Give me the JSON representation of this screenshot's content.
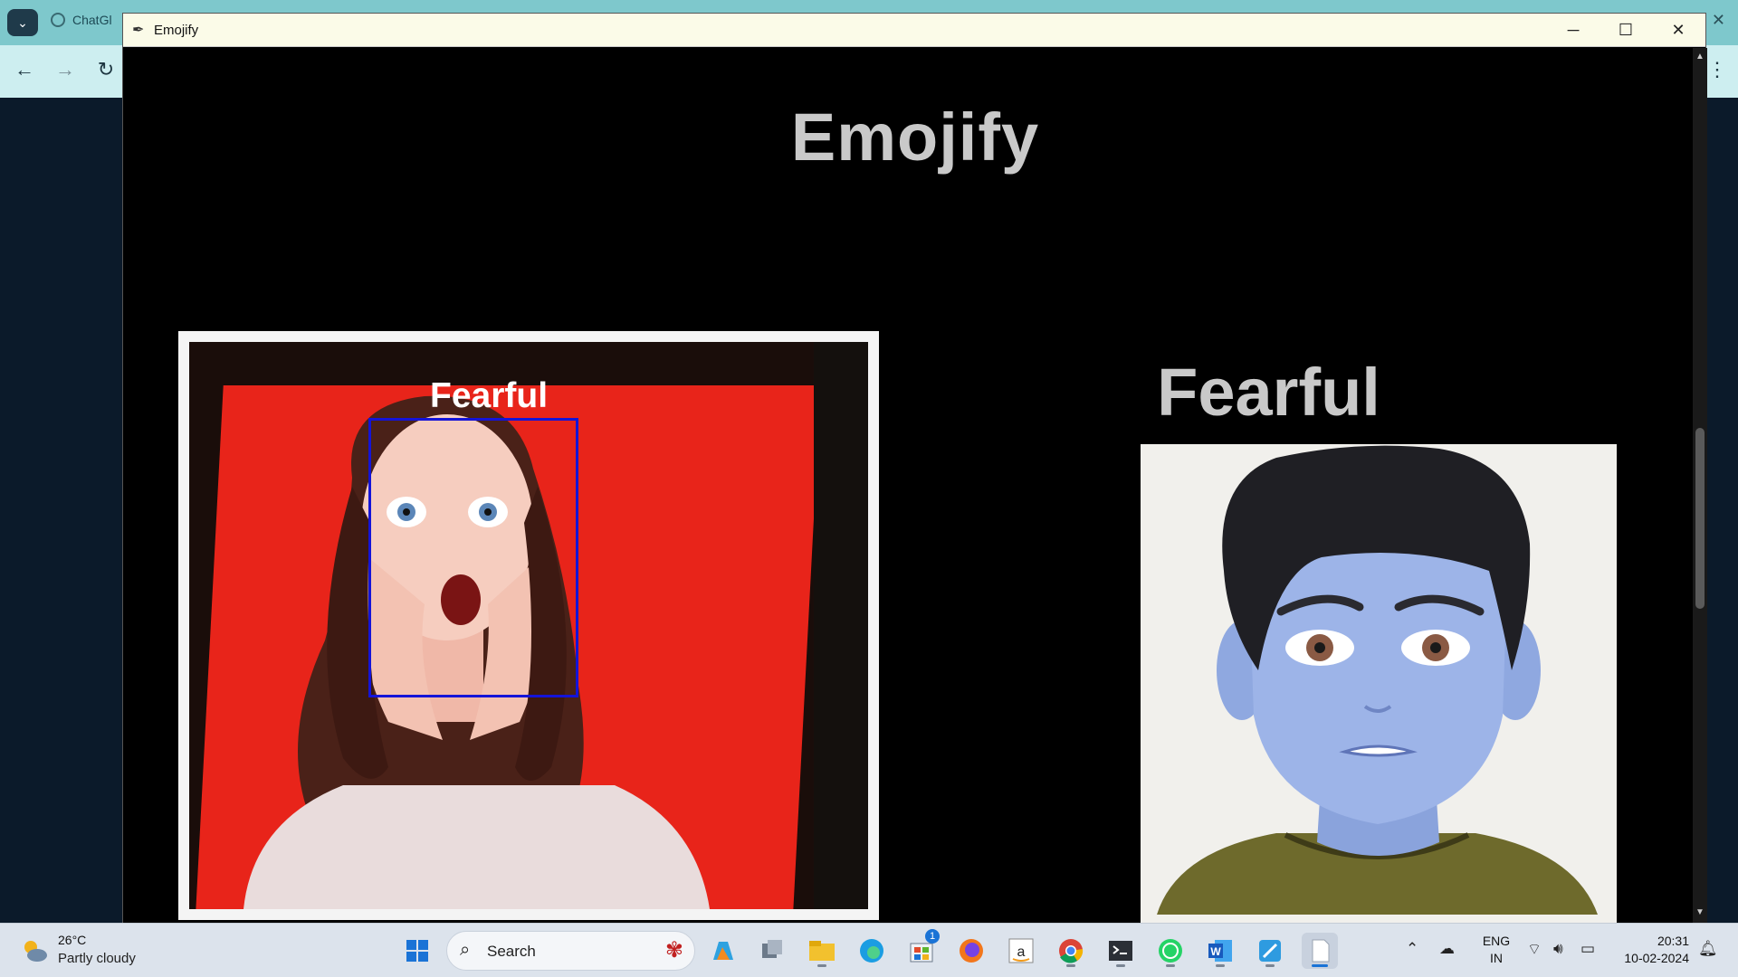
{
  "browser": {
    "tab_label": "ChatGl",
    "close_glyph": "✕",
    "back_glyph": "←",
    "forward_glyph": "→",
    "reload_glyph": "↻",
    "menu_glyph": "⋮",
    "tab_dropdown_glyph": "⌄"
  },
  "app": {
    "window_title": "Emojify",
    "heading": "Emojify",
    "minimize_glyph": "─",
    "maximize_glyph": "☐",
    "close_glyph": "✕",
    "camera_label": "Fearful",
    "emotion_title": "Fearful"
  },
  "taskbar": {
    "weather_temp": "26°C",
    "weather_desc": "Partly cloudy",
    "search_placeholder": "Search",
    "store_badge": "1",
    "lang_line1": "ENG",
    "lang_line2": "IN",
    "time": "20:31",
    "date": "10-02-2024"
  },
  "colors": {
    "face_box": "#1414d8",
    "heading_text": "#c9c9c9",
    "emoji_skin": "#9db4e8",
    "emoji_hair": "#1f1f24",
    "emoji_shirt": "#6e6a2c"
  },
  "icons": [
    "windows-start-icon",
    "copilot-icon",
    "task-view-icon",
    "file-explorer-icon",
    "edge-icon",
    "store-icon",
    "firefox-icon",
    "amazon-icon",
    "chrome-icon",
    "terminal-icon",
    "whatsapp-icon",
    "word-icon",
    "paint-icon",
    "notepad-icon"
  ]
}
